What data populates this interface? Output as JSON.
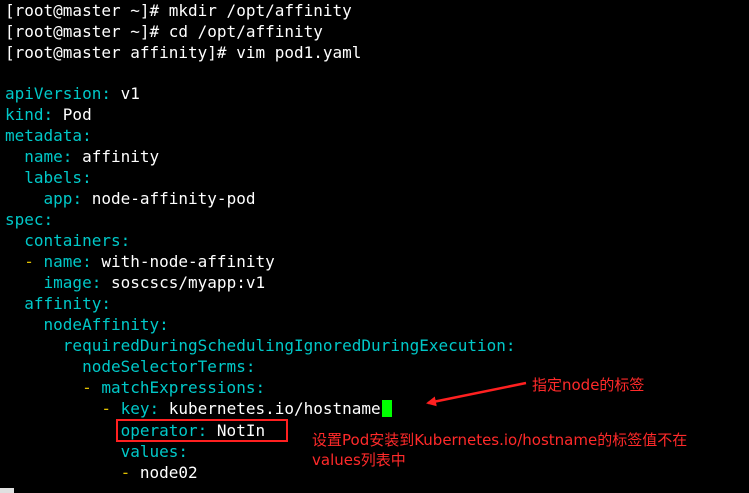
{
  "terminal": {
    "commands": [
      "[root@master ~]# mkdir /opt/affinity",
      "[root@master ~]# cd /opt/affinity",
      "[root@master affinity]# vim pod1.yaml"
    ],
    "yaml": {
      "apiVersion_key": "apiVersion",
      "apiVersion_val": "v1",
      "kind_key": "kind",
      "kind_val": "Pod",
      "metadata_key": "metadata",
      "name_key": "name",
      "name_val": "affinity",
      "labels_key": "labels",
      "app_key": "app",
      "app_val": "node-affinity-pod",
      "spec_key": "spec",
      "containers_key": "containers",
      "cname_key": "name",
      "cname_val": "with-node-affinity",
      "image_key": "image",
      "image_val": "soscscs/myapp:v1",
      "affinity_key": "affinity",
      "nodeAffinity_key": "nodeAffinity",
      "required_key": "requiredDuringSchedulingIgnoredDuringExecution",
      "nst_key": "nodeSelectorTerms",
      "me_key": "matchExpressions",
      "key_key": "key",
      "key_val": "kubernetes.io/hostname",
      "operator_key": "operator",
      "operator_val": "NotIn",
      "values_key": "values",
      "values_item": "node02"
    },
    "colors": {
      "key": "#00c8c8",
      "value": "#ffffff",
      "dash": "#e0c000",
      "cursor": "#00ff00",
      "annotation": "#ff2a2a"
    }
  },
  "annotations": {
    "note1": "指定node的标签",
    "note2_line1": "设置Pod安装到Kubernetes.io/hostname的标签值不在",
    "note2_line2": "values列表中"
  }
}
